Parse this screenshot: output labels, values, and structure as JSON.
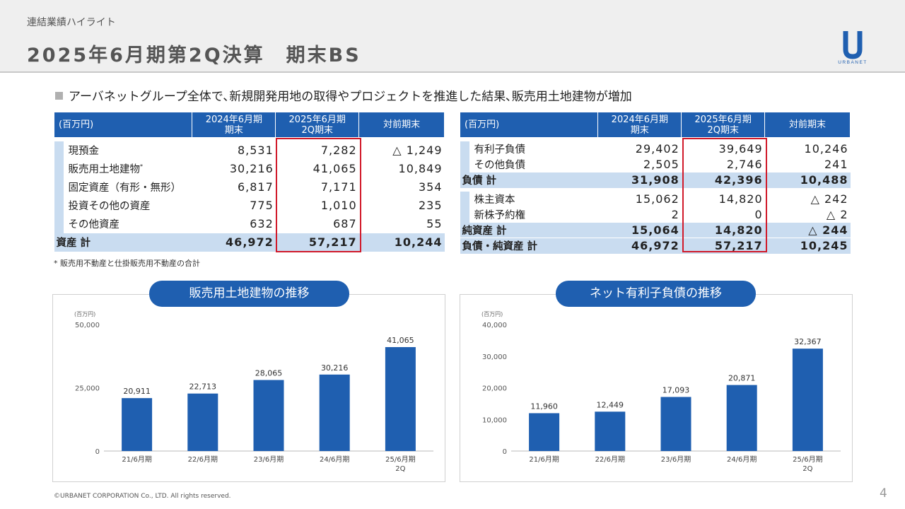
{
  "header": {
    "section_label": "連結業績ハイライト",
    "title": "2025年6月期第2Q決算　期末BS",
    "logo_text": "URBANET"
  },
  "headline": "アーバネットグループ全体で､新規開発用地の取得やプロジェクトを推進した結果､販売用土地建物が増加",
  "assets_table": {
    "unit": "(百万円)",
    "col_prev": [
      "2024年6月期",
      "期末"
    ],
    "col_curr": [
      "2025年6月期",
      "2Q期末"
    ],
    "col_diff": "対前期末",
    "rows": [
      {
        "label": "現預金",
        "prev": "8,531",
        "curr": "7,282",
        "diff": "△ 1,249"
      },
      {
        "label": "販売用土地建物",
        "sup": "*",
        "prev": "30,216",
        "curr": "41,065",
        "diff": "10,849"
      },
      {
        "label": "固定資産（有形・無形）",
        "prev": "6,817",
        "curr": "7,171",
        "diff": "354"
      },
      {
        "label": "投資その他の資産",
        "prev": "775",
        "curr": "1,010",
        "diff": "235"
      },
      {
        "label": "その他資産",
        "prev": "632",
        "curr": "687",
        "diff": "55"
      }
    ],
    "total": {
      "label": "資産 計",
      "prev": "46,972",
      "curr": "57,217",
      "diff": "10,244"
    }
  },
  "liabilities_table": {
    "unit": "(百万円)",
    "col_prev": [
      "2024年6月期",
      "期末"
    ],
    "col_curr": [
      "2025年6月期",
      "2Q期末"
    ],
    "col_diff": "対前期末",
    "liab_rows": [
      {
        "label": "有利子負債",
        "prev": "29,402",
        "curr": "39,649",
        "diff": "10,246"
      },
      {
        "label": "その他負債",
        "prev": "2,505",
        "curr": "2,746",
        "diff": "241"
      }
    ],
    "liab_total": {
      "label": "負債 計",
      "prev": "31,908",
      "curr": "42,396",
      "diff": "10,488"
    },
    "eq_rows": [
      {
        "label": "株主資本",
        "prev": "15,062",
        "curr": "14,820",
        "diff": "△ 242"
      },
      {
        "label": "新株予約権",
        "prev": "2",
        "curr": "0",
        "diff": "△ 2"
      }
    ],
    "eq_total": {
      "label": "純資産 計",
      "prev": "15,064",
      "curr": "14,820",
      "diff": "△ 244"
    },
    "grand_total": {
      "label": "負債・純資産 計",
      "prev": "46,972",
      "curr": "57,217",
      "diff": "10,245"
    }
  },
  "note": "* 販売用不動産と仕掛販売用不動産の合計",
  "chart_data": [
    {
      "type": "bar",
      "title": "販売用土地建物の推移",
      "ylabel": "(百万円)",
      "categories": [
        "21/6月期",
        "22/6月期",
        "23/6月期",
        "24/6月期",
        "25/6月期\n2Q"
      ],
      "values": [
        20911,
        22713,
        28065,
        30216,
        41065
      ],
      "value_labels": [
        "20,911",
        "22,713",
        "28,065",
        "30,216",
        "41,065"
      ],
      "yticks": [
        0,
        25000,
        50000
      ],
      "ytick_labels": [
        "0",
        "25,000",
        "50,000"
      ],
      "ylim": [
        0,
        50000
      ],
      "color": "#1f5fb0"
    },
    {
      "type": "bar",
      "title": "ネット有利子負債の推移",
      "ylabel": "(百万円)",
      "categories": [
        "21/6月期",
        "22/6月期",
        "23/6月期",
        "24/6月期",
        "25/6月期\n2Q"
      ],
      "values": [
        11960,
        12449,
        17093,
        20871,
        32367
      ],
      "value_labels": [
        "11,960",
        "12,449",
        "17,093",
        "20,871",
        "32,367"
      ],
      "yticks": [
        0,
        10000,
        20000,
        30000,
        40000
      ],
      "ytick_labels": [
        "0",
        "10,000",
        "20,000",
        "30,000",
        "40,000"
      ],
      "ylim": [
        0,
        40000
      ],
      "color": "#1f5fb0"
    }
  ],
  "footer": "©URBANET CORPORATION Co., LTD. All rights reserved.",
  "page_number": "4"
}
